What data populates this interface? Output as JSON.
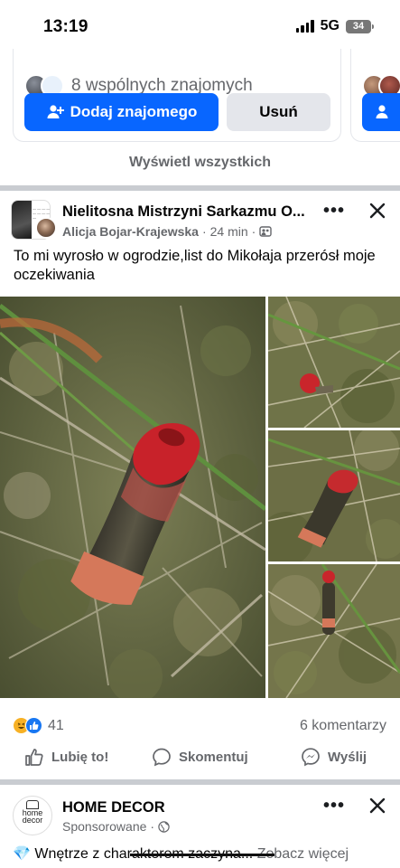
{
  "status_bar": {
    "time": "13:19",
    "network": "5G",
    "battery": "34"
  },
  "suggestions": {
    "mutual_friends": "8 wspólnych znajomych",
    "add_friend": "Dodaj znajomego",
    "remove": "Usuń",
    "see_all": "Wyświetl wszystkich"
  },
  "post": {
    "group_name": "Nielitosna Mistrzyni Sarkazmu O...",
    "author": "Alicja Bojar-Krajewska",
    "time": "24 min",
    "dot": "·",
    "text": "To mi wyrosło w ogrodzie,list do Mikołaja przerósł moje oczekiwania",
    "reaction_count": "41",
    "comments": "6 komentarzy",
    "actions": {
      "like": "Lubię to!",
      "comment": "Skomentuj",
      "share": "Wyślij"
    }
  },
  "ad": {
    "name": "HOME DECOR",
    "avatar_text": "home decor",
    "sponsored": "Sponsorowane",
    "dot": "·",
    "text_start": "Wnętrze z charakterem zaczyna...",
    "see_more": "Zobacz więcej"
  },
  "icons": {
    "signal": "signal-icon",
    "battery": "battery-icon",
    "add_friend": "person-add-icon",
    "more": "more-dots-icon",
    "close": "close-icon",
    "group": "group-icon",
    "globe": "globe-icon",
    "like": "thumbs-up-icon",
    "comment": "comment-bubble-icon",
    "share": "messenger-icon",
    "haha": "haha-reaction-icon",
    "like_reaction": "like-reaction-icon",
    "diamond": "diamond-icon"
  },
  "colors": {
    "brand_blue": "#0866ff",
    "secondary_text": "#65676b",
    "divider": "#c9ccd1",
    "button_grey": "#e4e6eb"
  }
}
